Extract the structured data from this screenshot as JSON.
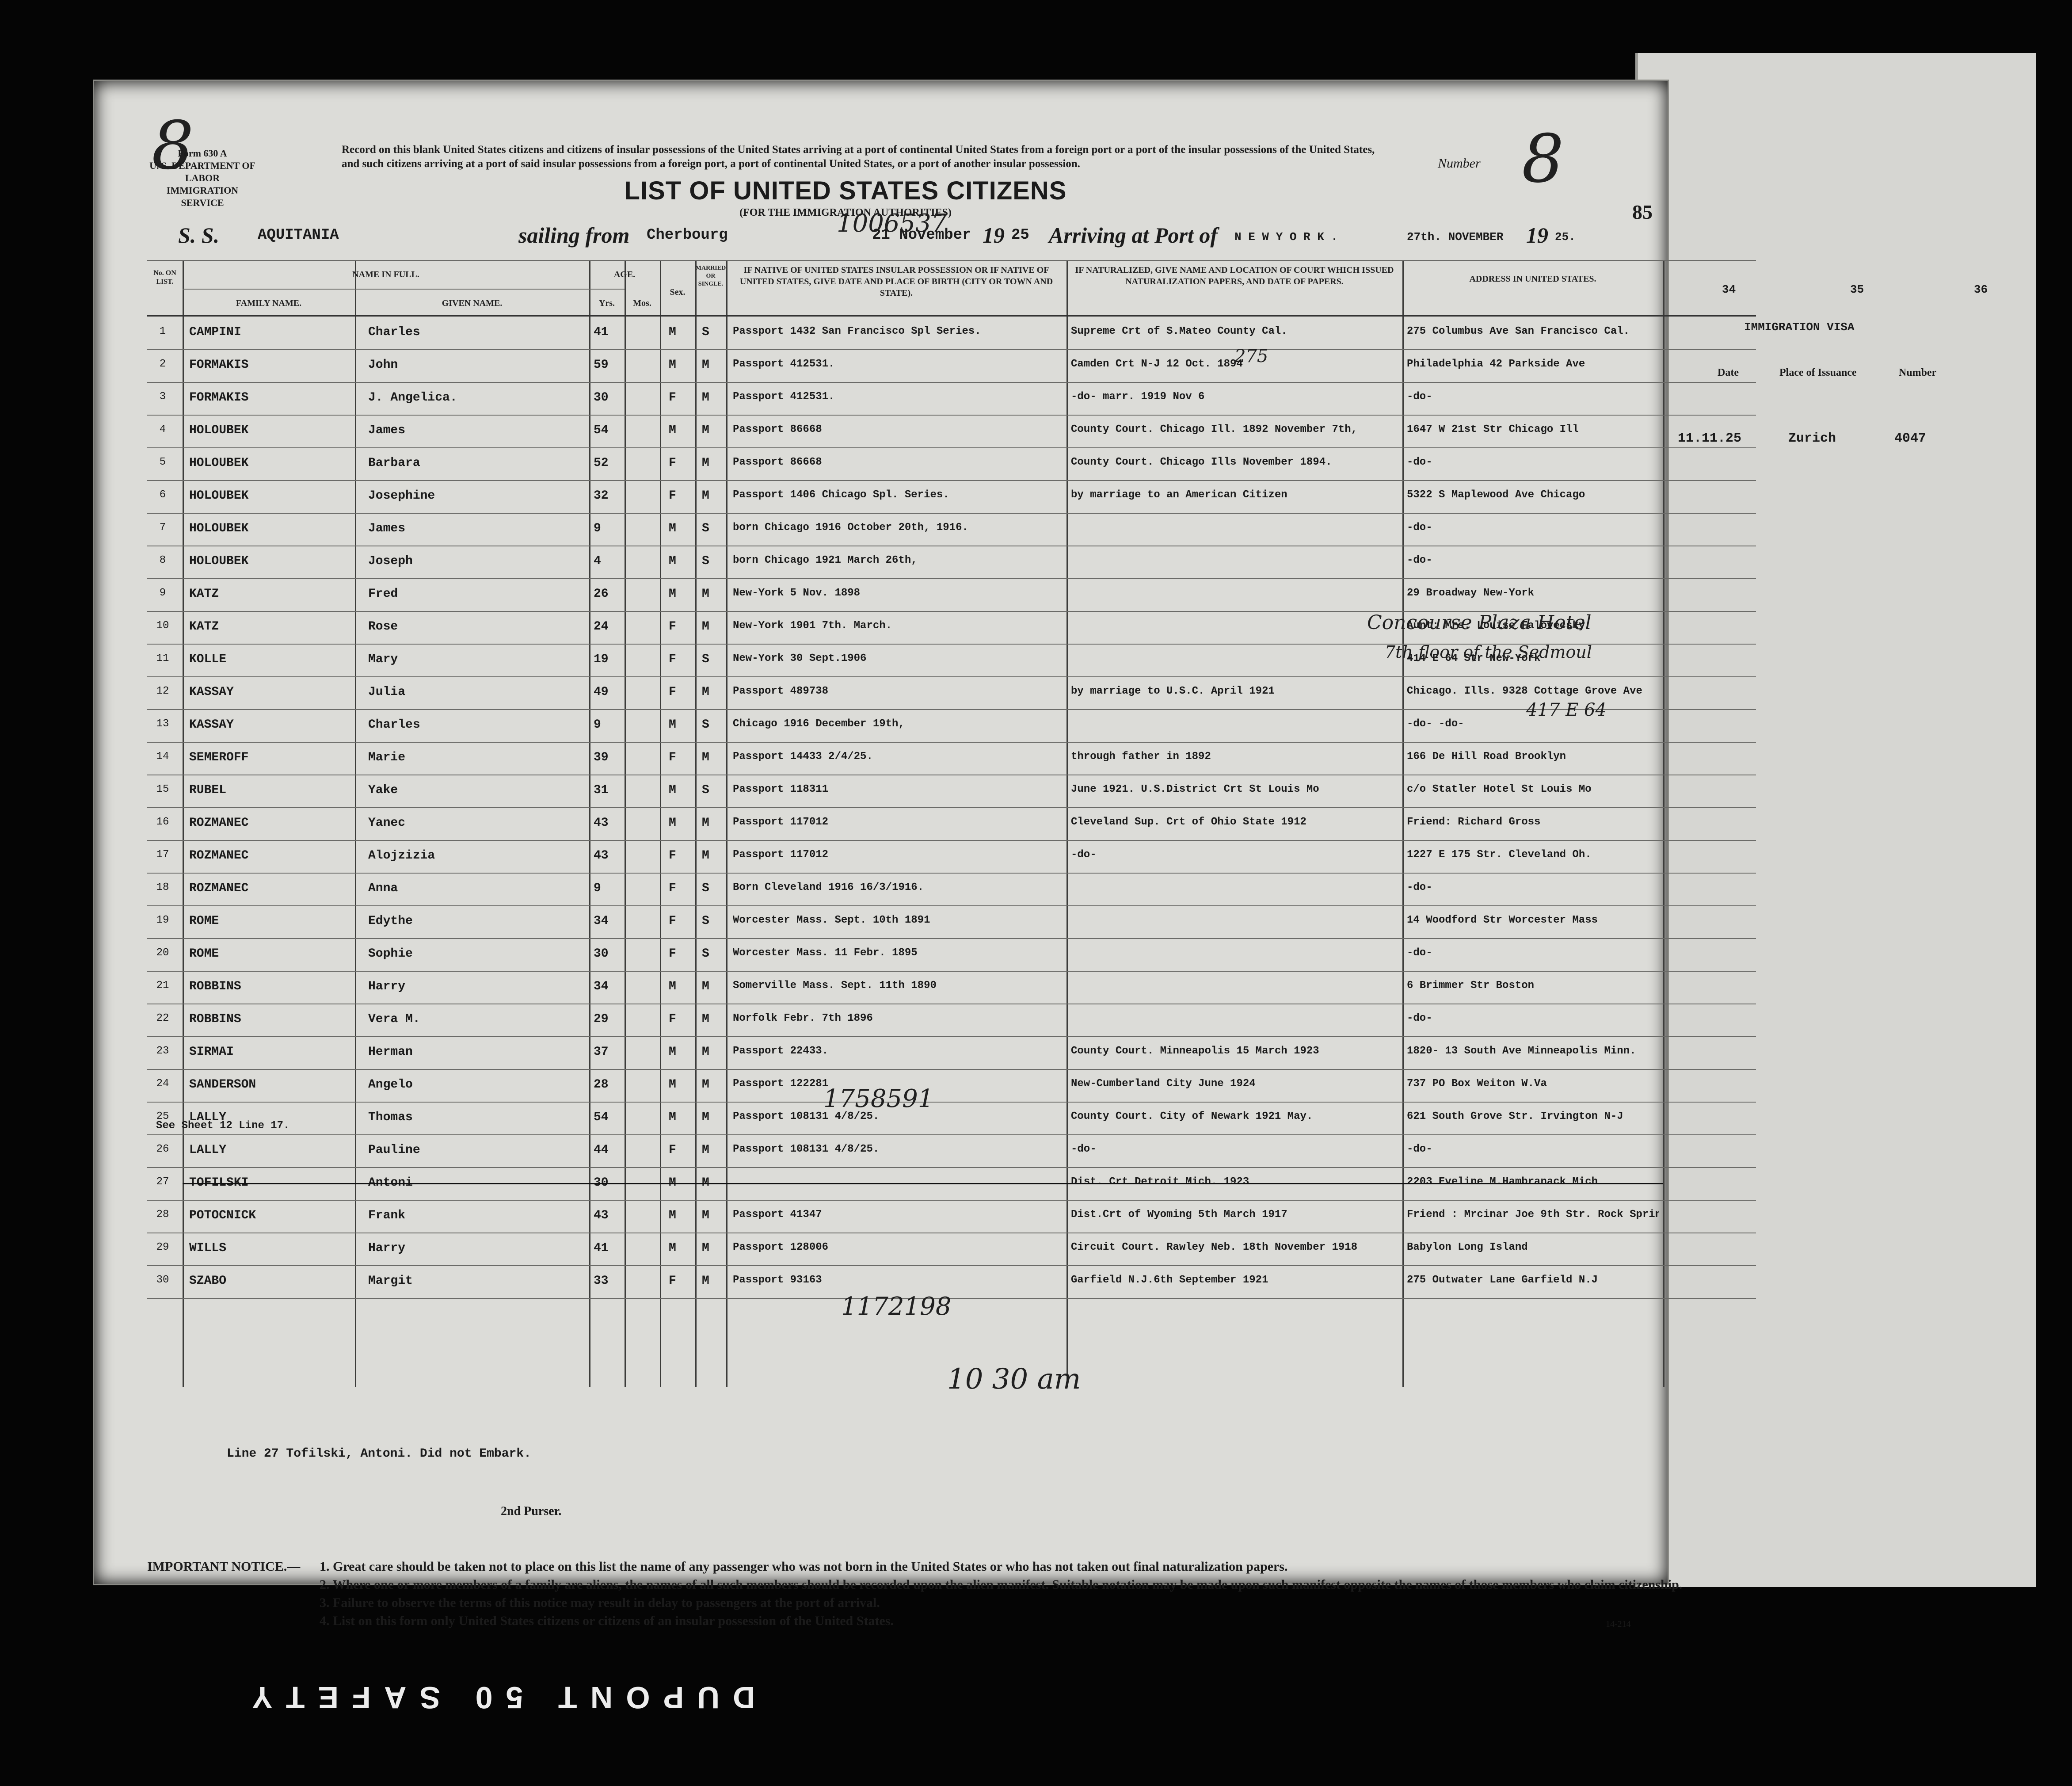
{
  "header": {
    "form_number": "Form 630 A",
    "department": "U. S. DEPARTMENT OF LABOR",
    "service": "IMMIGRATION SERVICE",
    "record_text": "Record on this blank United States citizens and citizens of insular possessions of the United States arriving at a port of continental United States from a foreign port or a port of the insular possessions of the United States, and such citizens arriving at a port of said insular possessions from a foreign port, a port of continental United States, or a port of another insular possession.",
    "number_label": "Number",
    "number_value": "8",
    "title": "LIST OF UNITED STATES CITIZENS",
    "subtitle": "(FOR THE IMMIGRATION AUTHORITIES)",
    "page_number": "85",
    "margin_mark": "8",
    "ss_label": "S. S.",
    "ship": "AQUITANIA",
    "sailing_from_label": "sailing from",
    "port_from": "Cherbourg",
    "depart_date": "21 November",
    "depart_year_prefix": "19",
    "depart_year": "25",
    "arriving_label": "Arriving at Port of",
    "port_to": "N E W   Y O R K .",
    "arrive_date": "27th. NOVEMBER",
    "arrive_year_prefix": "19",
    "arrive_year": "25."
  },
  "columns": {
    "no_on_list": "No. ON LIST.",
    "name_in_full": "NAME IN FULL.",
    "family_name": "FAMILY NAME.",
    "given_name": "GIVEN NAME.",
    "age": "AGE.",
    "yrs": "Yrs.",
    "mos": "Mos.",
    "sex": "Sex.",
    "married": "MARRIED OR SINGLE.",
    "birthplace": "IF NATIVE OF UNITED STATES INSULAR POSSESSION OR IF NATIVE OF UNITED STATES, GIVE DATE AND PLACE OF BIRTH (CITY OR TOWN AND STATE).",
    "naturalized": "IF NATURALIZED, GIVE NAME AND LOCATION OF COURT WHICH ISSUED NATURALIZATION PAPERS, AND DATE OF PAPERS.",
    "address": "ADDRESS IN UNITED STATES."
  },
  "right_page": {
    "col34": "34",
    "col35": "35",
    "col36": "36",
    "visa_title": "IMMIGRATION VISA",
    "date_label": "Date",
    "place_label": "Place of Issuance",
    "number_label": "Number",
    "visa_date": "11.11.25",
    "visa_place": "Zurich",
    "visa_number": "4047"
  },
  "rows": [
    {
      "n": "1",
      "family": "CAMPINI",
      "given": "Charles",
      "yrs": "41",
      "sex": "M",
      "ms": "S",
      "birth": "Passport   1432  San Francisco Spl Series.",
      "nat": "Supreme Crt of S.Mateo  County Cal.",
      "addr": "275 Columbus Ave San Francisco Cal."
    },
    {
      "n": "2",
      "family": "FORMAKIS",
      "given": "John",
      "yrs": "59",
      "sex": "M",
      "ms": "M",
      "birth": "Passport 412531.",
      "nat": "Camden Crt N-J 12 Oct. 1894",
      "addr": "Philadelphia 42 Parkside Ave"
    },
    {
      "n": "3",
      "family": "FORMAKIS",
      "given": "J. Angelica.",
      "yrs": "30",
      "sex": "F",
      "ms": "M",
      "birth": "Passport 412531.",
      "nat": "-do- marr. 1919 Nov 6",
      "addr": "-do-"
    },
    {
      "n": "4",
      "family": "HOLOUBEK",
      "given": "James",
      "yrs": "54",
      "sex": "M",
      "ms": "M",
      "birth": "Passport  86668",
      "nat": "County Court. Chicago Ill. 1892  November 7th,",
      "addr": "1647 W 21st Str Chicago Ill"
    },
    {
      "n": "5",
      "family": "HOLOUBEK",
      "given": "Barbara",
      "yrs": "52",
      "sex": "F",
      "ms": "M",
      "birth": "Passport  86668",
      "nat": "County Court. Chicago Ills  November 1894.",
      "addr": "-do-"
    },
    {
      "n": "6",
      "family": "HOLOUBEK",
      "given": "Josephine",
      "yrs": "32",
      "sex": "F",
      "ms": "M",
      "birth": "Passport 1406    Chicago Spl. Series.",
      "nat": "by marriage to an American Citizen",
      "addr": "5322 S Maplewood Ave Chicago"
    },
    {
      "n": "7",
      "family": "HOLOUBEK",
      "given": "James",
      "yrs": "9",
      "sex": "M",
      "ms": "S",
      "birth": "born Chicago 1916 October 20th, 1916.",
      "nat": "",
      "addr": "-do-"
    },
    {
      "n": "8",
      "family": "HOLOUBEK",
      "given": "Joseph",
      "yrs": "4",
      "sex": "M",
      "ms": "S",
      "birth": "born Chicago 1921  March 26th,",
      "nat": "",
      "addr": "-do-"
    },
    {
      "n": "9",
      "family": "KATZ",
      "given": "Fred",
      "yrs": "26",
      "sex": "M",
      "ms": "M",
      "birth": "New-York 5 Nov. 1898",
      "nat": "",
      "addr": "29 Broadway New-York"
    },
    {
      "n": "10",
      "family": "KATZ",
      "given": "Rose",
      "yrs": "24",
      "sex": "F",
      "ms": "M",
      "birth": "New-York 1901     7th. March.",
      "nat": "",
      "addr": "Aunt: Mrs. Louise Falovecsky"
    },
    {
      "n": "11",
      "family": "KOLLE",
      "given": "Mary",
      "yrs": "19",
      "sex": "F",
      "ms": "S",
      "birth": "New-York 30 Sept.1906",
      "nat": "",
      "addr": "414 E 64 Str New-York"
    },
    {
      "n": "12",
      "family": "KASSAY",
      "given": "Julia",
      "yrs": "49",
      "sex": "F",
      "ms": "M",
      "birth": "Passport  489738",
      "nat": "by marriage to U.S.C. April 1921",
      "addr": "Chicago. Ills. 9328 Cottage Grove Ave"
    },
    {
      "n": "13",
      "family": "KASSAY",
      "given": "Charles",
      "yrs": "9",
      "sex": "M",
      "ms": "S",
      "birth": "Chicago 1916   December 19th,",
      "nat": "",
      "addr": "-do-      -do-"
    },
    {
      "n": "14",
      "family": "SEMEROFF",
      "given": "Marie",
      "yrs": "39",
      "sex": "F",
      "ms": "M",
      "birth": "Passport 14433        2/4/25.",
      "nat": "through father in 1892",
      "addr": "166 De Hill Road Brooklyn"
    },
    {
      "n": "15",
      "family": "RUBEL",
      "given": "Yake",
      "yrs": "31",
      "sex": "M",
      "ms": "S",
      "birth": "Passport 118311",
      "nat": "June 1921. U.S.District Crt St Louis Mo",
      "addr": "c/o Statler Hotel St Louis Mo"
    },
    {
      "n": "16",
      "family": "ROZMANEC",
      "given": "Yanec",
      "yrs": "43",
      "sex": "M",
      "ms": "M",
      "birth": "Passport  117012",
      "nat": "Cleveland Sup. Crt of Ohio State 1912",
      "addr": "Friend: Richard Gross"
    },
    {
      "n": "17",
      "family": "ROZMANEC",
      "given": "Alojzizia",
      "yrs": "43",
      "sex": "F",
      "ms": "M",
      "birth": "Passport   117012",
      "nat": "-do-",
      "addr": "1227 E 175 Str. Cleveland Oh."
    },
    {
      "n": "18",
      "family": "ROZMANEC",
      "given": "Anna",
      "yrs": "9",
      "sex": "F",
      "ms": "S",
      "birth": "Born Cleveland 1916  16/3/1916.",
      "nat": "",
      "addr": "-do-"
    },
    {
      "n": "19",
      "family": "ROME",
      "given": "Edythe",
      "yrs": "34",
      "sex": "F",
      "ms": "S",
      "birth": "Worcester Mass. Sept. 10th 1891",
      "nat": "",
      "addr": "14 Woodford Str Worcester Mass"
    },
    {
      "n": "20",
      "family": "ROME",
      "given": "Sophie",
      "yrs": "30",
      "sex": "F",
      "ms": "S",
      "birth": "Worcester Mass. 11 Febr. 1895",
      "nat": "",
      "addr": "-do-"
    },
    {
      "n": "21",
      "family": "ROBBINS",
      "given": "Harry",
      "yrs": "34",
      "sex": "M",
      "ms": "M",
      "birth": "Somerville Mass. Sept. 11th 1890",
      "nat": "",
      "addr": "6 Brimmer Str Boston"
    },
    {
      "n": "22",
      "family": "ROBBINS",
      "given": "Vera M.",
      "yrs": "29",
      "sex": "F",
      "ms": "M",
      "birth": "Norfolk Febr. 7th 1896",
      "nat": "",
      "addr": "-do-"
    },
    {
      "n": "23",
      "family": "SIRMAI",
      "given": "Herman",
      "yrs": "37",
      "sex": "M",
      "ms": "M",
      "birth": "Passport 22433.",
      "nat": "County Court. Minneapolis 15 March 1923",
      "addr": "1820- 13 South Ave Minneapolis Minn."
    },
    {
      "n": "24",
      "family": "SANDERSON",
      "given": "Angelo",
      "yrs": "28",
      "sex": "M",
      "ms": "M",
      "birth": "Passport 122281",
      "nat": "New-Cumberland City  June 1924",
      "addr": "737 PO Box Weiton W.Va"
    },
    {
      "n": "25",
      "family": "LALLY",
      "given": "Thomas",
      "yrs": "54",
      "sex": "M",
      "ms": "M",
      "birth": "Passport 108131    4/8/25.",
      "nat": "County Court. City of Newark 1921  May.",
      "addr": "621 South Grove Str. Irvington N-J"
    },
    {
      "n": "26",
      "family": "LALLY",
      "given": "Pauline",
      "yrs": "44",
      "sex": "F",
      "ms": "M",
      "birth": "Passport 108131    4/8/25.",
      "nat": "-do-",
      "addr": "-do-"
    },
    {
      "n": "27",
      "family": "TOFILSKI",
      "given": "Antoni",
      "yrs": "30",
      "sex": "M",
      "ms": "M",
      "birth": "",
      "nat": "Dist. Crt Detroit Mich. 1923",
      "addr": "2203 Eveline M.Hambranack Mich"
    },
    {
      "n": "28",
      "family": "POTOCNICK",
      "given": "Frank",
      "yrs": "43",
      "sex": "M",
      "ms": "M",
      "birth": "Passport 41347",
      "nat": "Dist.Crt of Wyoming  5th March 1917",
      "addr": "Friend : Mrcinar Joe  9th Str. Rock Springs Wyo"
    },
    {
      "n": "29",
      "family": "WILLS",
      "given": "Harry",
      "yrs": "41",
      "sex": "M",
      "ms": "M",
      "birth": "Passport 128006",
      "nat": "Circuit Court. Rawley Neb. 18th November 1918",
      "addr": "Babylon Long Island"
    },
    {
      "n": "30",
      "family": "SZABO",
      "given": "Margit",
      "yrs": "33",
      "sex": "F",
      "ms": "M",
      "birth": "Passport 93163",
      "nat": "Garfield N.J.6th September 1921",
      "addr": "275  Outwater Lane Garfield N.J"
    }
  ],
  "handwritten": {
    "n1": "1006537",
    "n2": "1758591",
    "n3": "1172198",
    "hotel": "Concourse Plaza Hotel",
    "aside": "7th floor of the Sedmoul",
    "addr11": "417 E 64",
    "time": "10 30 am",
    "addr1_num": "275",
    "sheet_note": "See Sheet 12 Line 17."
  },
  "footer": {
    "note": "Line 27 Tofilski, Antoni. Did not Embark.",
    "purser": "2nd Purser.",
    "notice_label": "IMPORTANT NOTICE.—",
    "notice_items": [
      "1. Great care should be taken not to place on this list the name of any passenger who was not born in the United States or who has not taken out final naturalization papers.",
      "2. Where one or more members of a family are aliens, the names of all such members should be recorded upon the alien manifest. Suitable notation may be made upon such manifest opposite the names of those members who claim citizenship.",
      "3. Failure to observe the terms of this notice may result in delay to passengers at the port of arrival.",
      "4. List on this form only United States citizens or citizens of an insular possession of the United States."
    ],
    "form_code": "14-214",
    "stamp": "DUPONT 50 SAFETY"
  }
}
